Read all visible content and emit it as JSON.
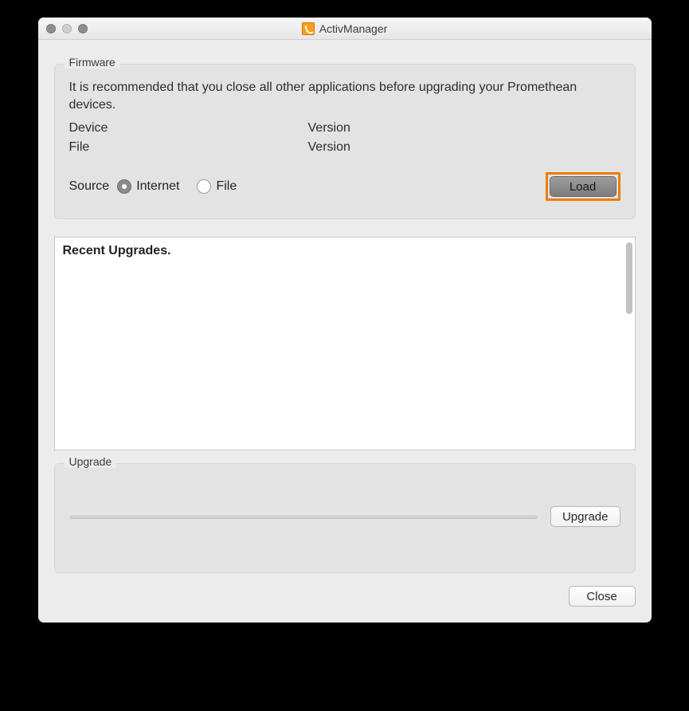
{
  "window": {
    "title": "ActivManager"
  },
  "firmware": {
    "group_label": "Firmware",
    "info": "It is recommended that you close all other applications before upgrading your Promethean devices.",
    "device_label": "Device",
    "device_version_label": "Version",
    "file_label": "File",
    "file_version_label": "Version",
    "source_label": "Source",
    "radio_internet": "Internet",
    "radio_file": "File",
    "selected_source": "Internet",
    "load_button": "Load"
  },
  "recent": {
    "heading": "Recent Upgrades.",
    "items": []
  },
  "upgrade": {
    "group_label": "Upgrade",
    "progress_percent": 0,
    "button": "Upgrade"
  },
  "footer": {
    "close_button": "Close"
  }
}
